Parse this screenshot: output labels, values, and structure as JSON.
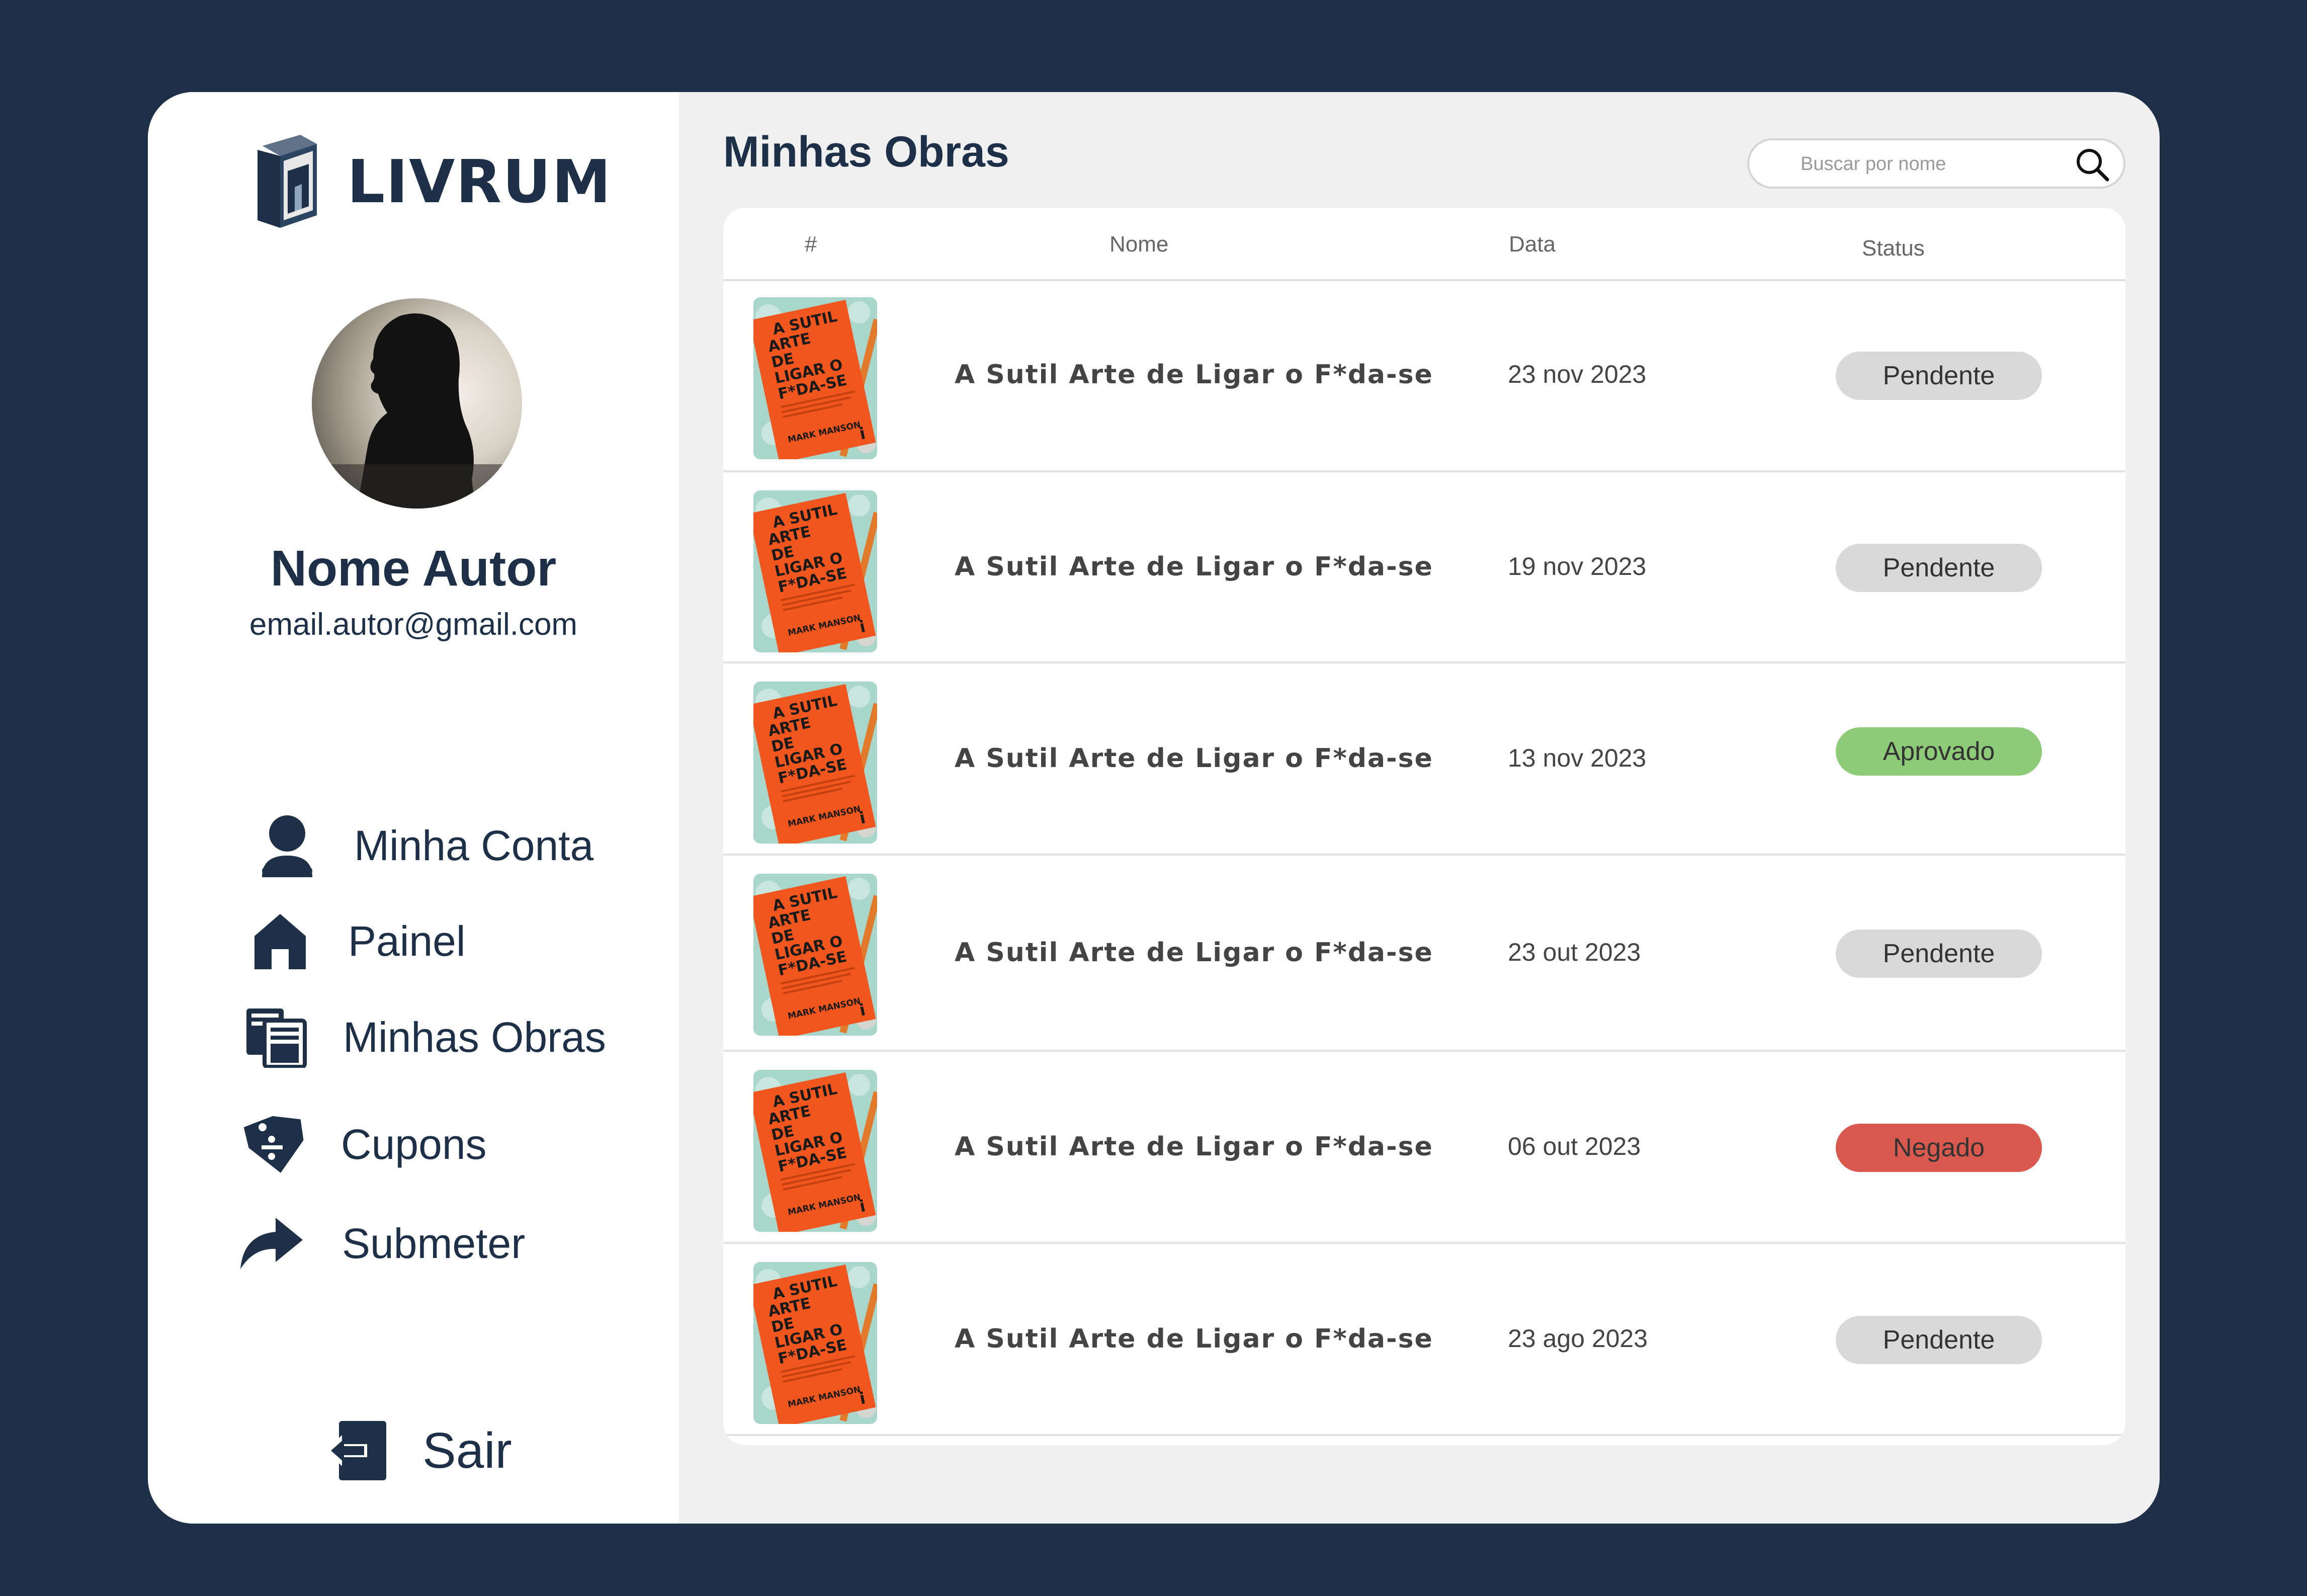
{
  "brand": {
    "name": "LIVRUM"
  },
  "profile": {
    "name": "Nome Autor",
    "email": "email.autor@gmail.com"
  },
  "sidebar": {
    "items": [
      {
        "label": "Minha Conta",
        "icon": "user-icon"
      },
      {
        "label": "Painel",
        "icon": "home-icon"
      },
      {
        "label": "Minhas Obras",
        "icon": "books-icon"
      },
      {
        "label": "Cupons",
        "icon": "coupon-icon"
      },
      {
        "label": "Submeter",
        "icon": "share-arrow-icon"
      }
    ],
    "logout": {
      "label": "Sair",
      "icon": "logout-icon"
    }
  },
  "main": {
    "title": "Minhas Obras",
    "search": {
      "placeholder": "Buscar por nome",
      "icon": "search-icon"
    },
    "table": {
      "columns": [
        "#",
        "Nome",
        "Data",
        "Status"
      ],
      "rows": [
        {
          "title": "A Sutil Arte de Ligar o F*da-se",
          "date": "23 nov 2023",
          "status": "Pendente"
        },
        {
          "title": "A Sutil Arte de Ligar o F*da-se",
          "date": "19 nov 2023",
          "status": "Pendente"
        },
        {
          "title": "A Sutil Arte de Ligar o F*da-se",
          "date": "13 nov 2023",
          "status": "Aprovado"
        },
        {
          "title": "A Sutil Arte de Ligar o F*da-se",
          "date": "23 out 2023",
          "status": "Pendente"
        },
        {
          "title": "A Sutil Arte de Ligar o F*da-se",
          "date": "06 out 2023",
          "status": "Negado"
        },
        {
          "title": "A Sutil Arte de Ligar o F*da-se",
          "date": "23 ago 2023",
          "status": "Pendente"
        }
      ]
    },
    "cover": {
      "line1": "A SUTIL",
      "line2": "ARTE",
      "line3": "DE",
      "line4": "LIGAR O",
      "line5": "F*DA-SE",
      "author": "MARK MANSON",
      "publisher": "i"
    }
  },
  "colors": {
    "brand_navy": "#1d3047",
    "status_pendente": "#d9d9d9",
    "status_aprovado": "#8ecb78",
    "status_negado": "#d9594f"
  }
}
